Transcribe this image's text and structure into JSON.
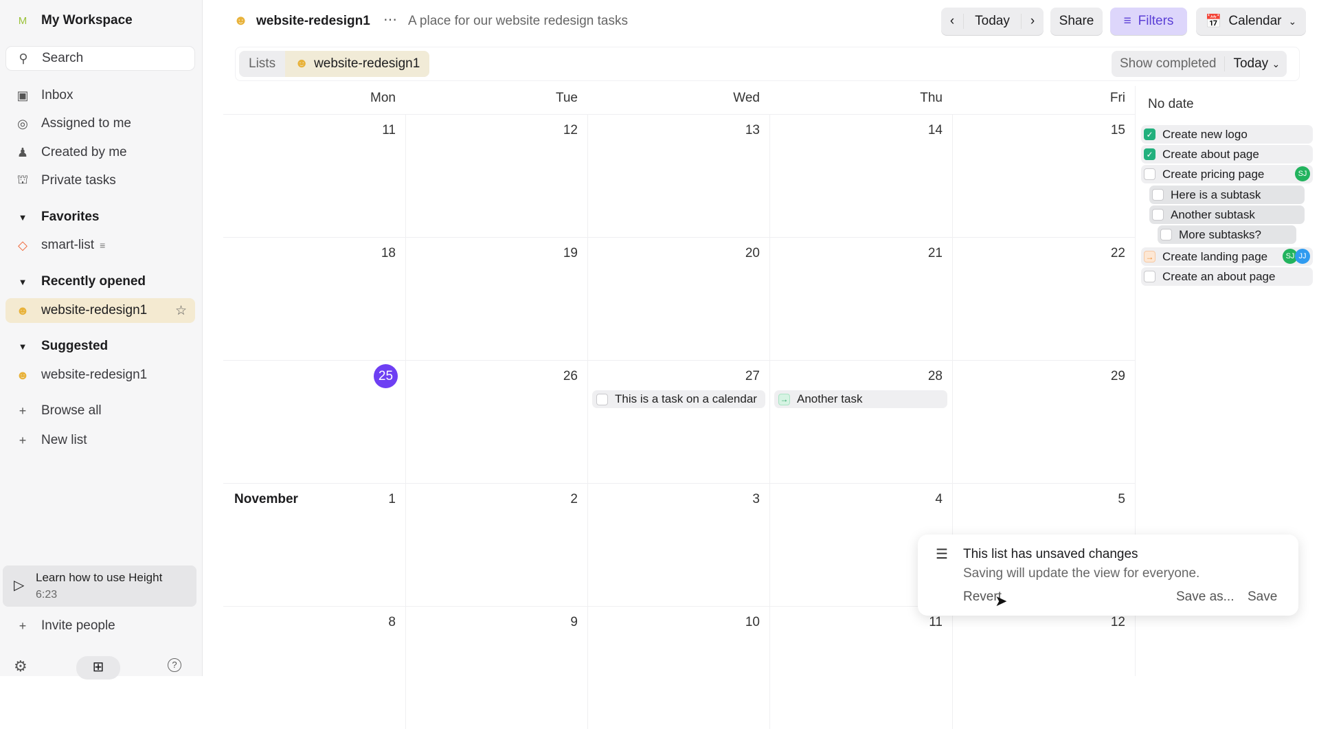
{
  "sidebar": {
    "workspace_initial": "M",
    "workspace_name": "My Workspace",
    "search_placeholder": "Search",
    "nav": [
      {
        "label": "Inbox",
        "icon": "inbox-icon"
      },
      {
        "label": "Assigned to me",
        "icon": "target-icon"
      },
      {
        "label": "Created by me",
        "icon": "user-icon"
      },
      {
        "label": "Private tasks",
        "icon": "lock-icon"
      }
    ],
    "favorites_label": "Favorites",
    "favorites": [
      {
        "label": "smart-list",
        "icon": "smart-list-icon"
      }
    ],
    "recent_label": "Recently opened",
    "recent": [
      {
        "label": "website-redesign1",
        "icon": "list-icon"
      }
    ],
    "suggested_label": "Suggested",
    "suggested": [
      {
        "label": "website-redesign1",
        "icon": "list-icon"
      }
    ],
    "browse_all": "Browse all",
    "new_list": "New list",
    "learn_title": "Learn how to use Height",
    "learn_duration": "6:23",
    "invite": "Invite people"
  },
  "header": {
    "list_name": "website-redesign1",
    "description": "A place for our website redesign tasks",
    "today": "Today",
    "share": "Share",
    "filters": "Filters",
    "view": "Calendar",
    "accent": "#ddd6fb"
  },
  "breadcrumb": {
    "root": "Lists",
    "current": "website-redesign1"
  },
  "toolbar": {
    "show_completed": "Show completed",
    "range": "Today"
  },
  "calendar": {
    "days": [
      "Mon",
      "Tue",
      "Wed",
      "Thu",
      "Fri"
    ],
    "weeks": [
      {
        "label": "",
        "dates": [
          "11",
          "12",
          "13",
          "14",
          "15"
        ]
      },
      {
        "label": "",
        "dates": [
          "18",
          "19",
          "20",
          "21",
          "22"
        ]
      },
      {
        "label": "",
        "dates": [
          "25",
          "26",
          "27",
          "28",
          "29"
        ]
      },
      {
        "label": "November",
        "dates": [
          "1",
          "2",
          "3",
          "4",
          "5"
        ]
      },
      {
        "label": "",
        "dates": [
          "8",
          "9",
          "10",
          "11",
          "12"
        ]
      }
    ],
    "today": "25",
    "today_color": "#6e3ff3",
    "tasks": [
      {
        "title": "This is a task on a calendar",
        "date": "27",
        "status": "todo"
      },
      {
        "title": "Another task",
        "date": "28",
        "status": "in-progress"
      }
    ]
  },
  "no_date": {
    "title": "No date",
    "tasks": [
      {
        "title": "Create new logo",
        "status": "done",
        "level": 0
      },
      {
        "title": "Create about page",
        "status": "done",
        "level": 0
      },
      {
        "title": "Create pricing page",
        "status": "todo",
        "level": 0,
        "assignees": [
          "SJ"
        ]
      },
      {
        "title": "Here is a subtask",
        "status": "todo",
        "level": 1
      },
      {
        "title": "Another subtask",
        "status": "todo",
        "level": 1
      },
      {
        "title": "More subtasks?",
        "status": "todo",
        "level": 2
      },
      {
        "title": "Create landing page",
        "status": "in-progress",
        "level": 0,
        "assignees": [
          "SJ",
          "JJ"
        ]
      },
      {
        "title": "Create an about page",
        "status": "todo",
        "level": 0
      }
    ]
  },
  "toast": {
    "title": "This list has unsaved changes",
    "message": "Saving will update the view for everyone.",
    "revert": "Revert",
    "save_as": "Save as...",
    "save": "Save"
  }
}
